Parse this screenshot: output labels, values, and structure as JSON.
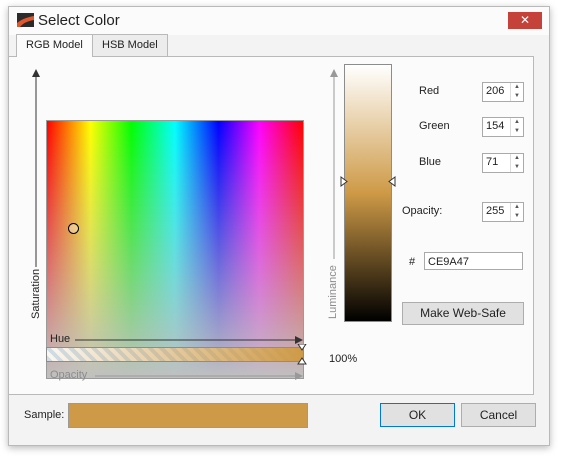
{
  "window": {
    "title": "Select Color",
    "close_glyph": "✕"
  },
  "tabs": [
    {
      "label": "RGB Model",
      "active": true
    },
    {
      "label": "HSB Model",
      "active": false
    }
  ],
  "palette": {
    "hue_label": "Hue",
    "saturation_label": "Saturation",
    "opacity_label": "Opacity"
  },
  "luminance": {
    "label": "Luminance"
  },
  "opacity_percent": "100%",
  "fields": {
    "red": {
      "label": "Red",
      "value": "206"
    },
    "green": {
      "label": "Green",
      "value": "154"
    },
    "blue": {
      "label": "Blue",
      "value": "71"
    },
    "opacity": {
      "label": "Opacity:",
      "value": "255"
    }
  },
  "hex": {
    "prefix": "#",
    "value": "CE9A47"
  },
  "buttons": {
    "web_safe": "Make Web-Safe",
    "ok": "OK",
    "cancel": "Cancel"
  },
  "sample": {
    "label": "Sample:",
    "color": "#ce9a47"
  },
  "colors": {
    "accent_close": "#c5423b",
    "selected": "#ce9a47"
  }
}
